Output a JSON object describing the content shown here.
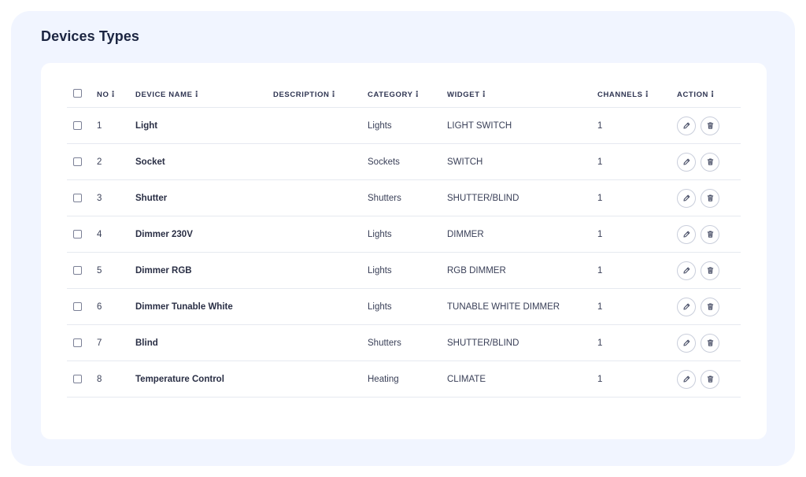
{
  "page": {
    "title": "Devices Types"
  },
  "table": {
    "columns": {
      "no": "NO",
      "device_name": "DEVICE NAME",
      "description": "DESCRIPTION",
      "category": "CATEGORY",
      "widget": "WIDGET",
      "channels": "CHANNELS",
      "action": "ACTION"
    },
    "sort_glyph": "⁝",
    "rows": [
      {
        "no": "1",
        "name": "Light",
        "description": "",
        "category": "Lights",
        "widget": "LIGHT SWITCH",
        "channels": "1"
      },
      {
        "no": "2",
        "name": "Socket",
        "description": "",
        "category": "Sockets",
        "widget": "SWITCH",
        "channels": "1"
      },
      {
        "no": "3",
        "name": "Shutter",
        "description": "",
        "category": "Shutters",
        "widget": "SHUTTER/BLIND",
        "channels": "1"
      },
      {
        "no": "4",
        "name": "Dimmer 230V",
        "description": "",
        "category": "Lights",
        "widget": "DIMMER",
        "channels": "1"
      },
      {
        "no": "5",
        "name": "Dimmer RGB",
        "description": "",
        "category": "Lights",
        "widget": "RGB DIMMER",
        "channels": "1"
      },
      {
        "no": "6",
        "name": "Dimmer Tunable White",
        "description": "",
        "category": "Lights",
        "widget": "TUNABLE WHITE DIMMER",
        "channels": "1"
      },
      {
        "no": "7",
        "name": "Blind",
        "description": "",
        "category": "Shutters",
        "widget": "SHUTTER/BLIND",
        "channels": "1"
      },
      {
        "no": "8",
        "name": "Temperature Control",
        "description": "",
        "category": "Heating",
        "widget": "CLIMATE",
        "channels": "1"
      }
    ]
  },
  "icons": {
    "row_actions": [
      "edit-icon",
      "trash-icon"
    ]
  },
  "colors": {
    "panel_background": "#f1f5ff",
    "card_background": "#ffffff",
    "title": "#1c2541",
    "divider": "#e6e9f0"
  }
}
